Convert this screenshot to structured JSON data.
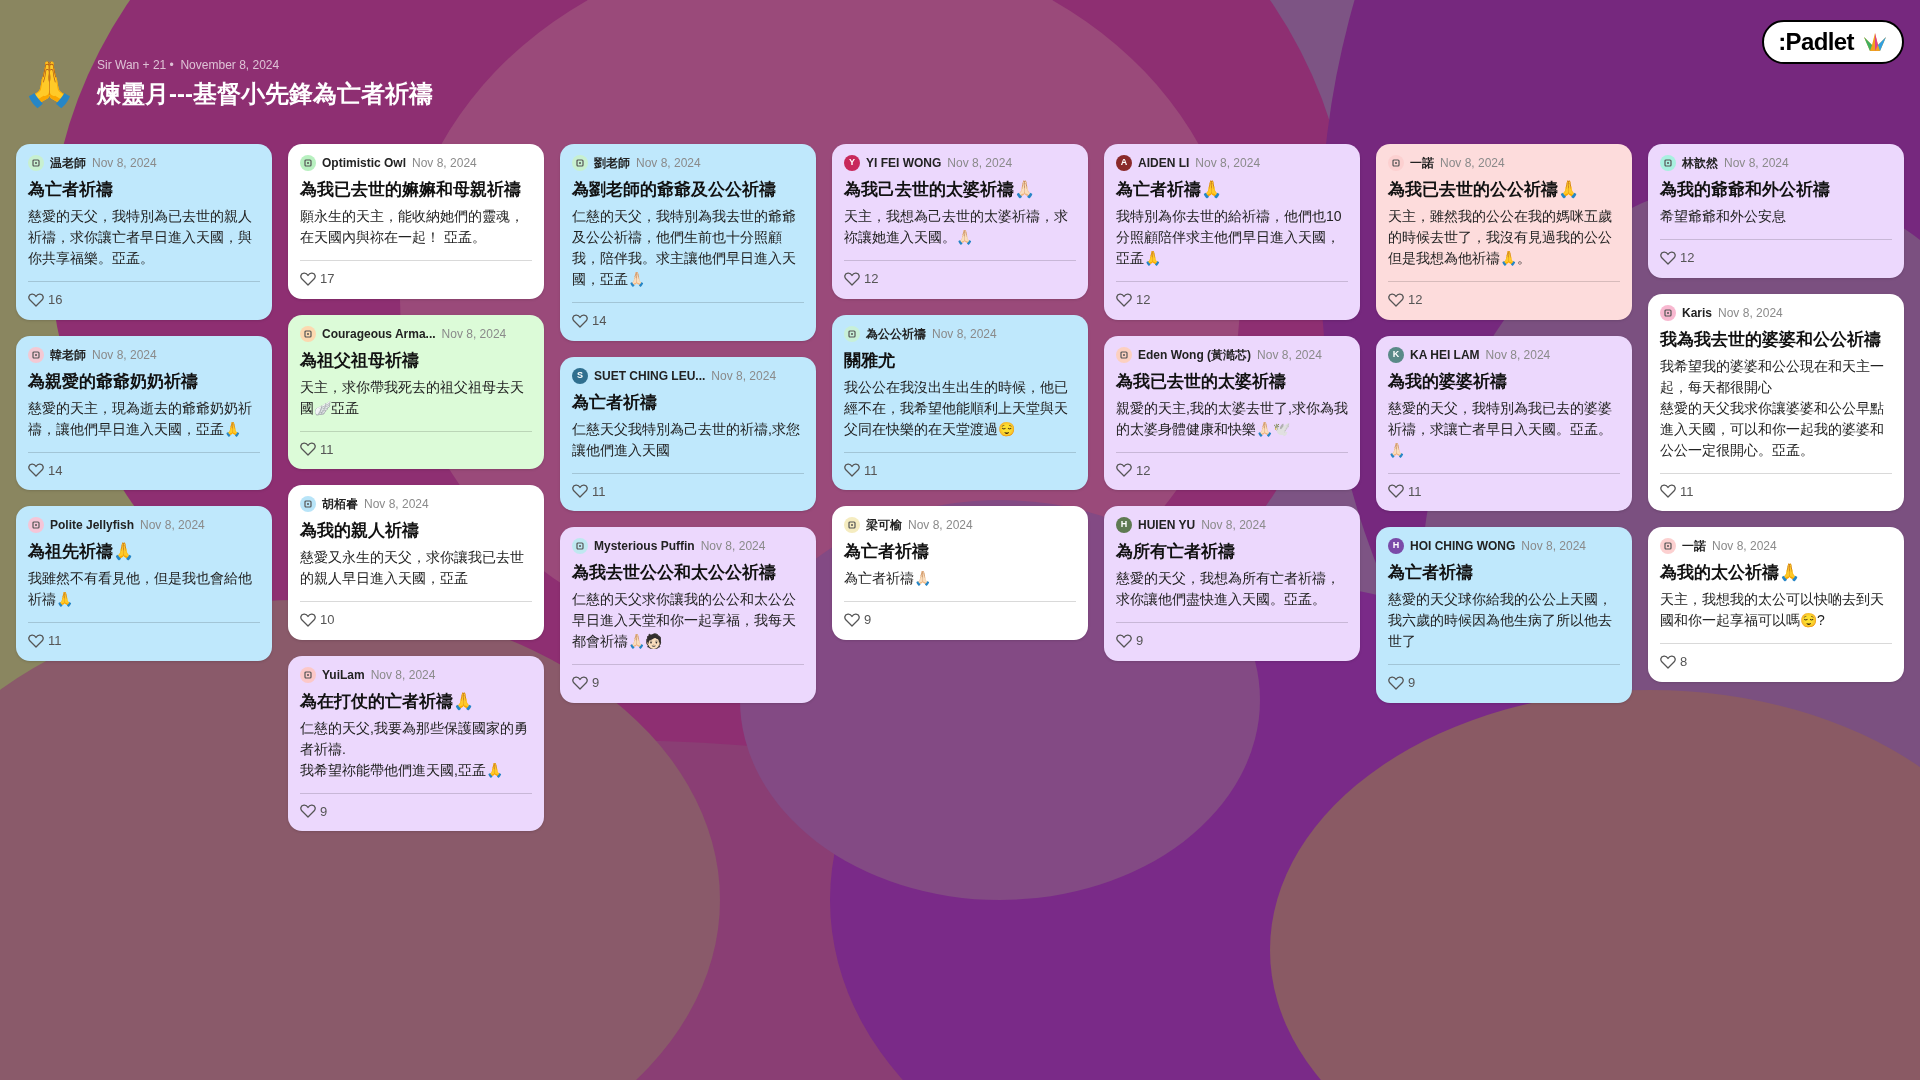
{
  "header": {
    "emoji": "🙏",
    "meta": "Sir Wan + 21 •  November 8, 2024",
    "title": "煉靈月---基督小先鋒為亡者祈禱"
  },
  "logo": ":Padlet",
  "columns": [
    {
      "cards": [
        {
          "author": "温老師",
          "avatar": {
            "color": "#c8f0d0"
          },
          "date": "Nov 8, 2024",
          "title": "為亡者祈禱",
          "body": "慈愛的天父，我特別為已去世的親人祈禱，求你讓亡者早日進入天國，與你共享福樂。亞孟。",
          "likes": "16",
          "color": "#bfe8fc"
        },
        {
          "author": "韓老師",
          "avatar": {
            "color": "#f3c9d4"
          },
          "date": "Nov 8, 2024",
          "title": "為親愛的爺爺奶奶祈禱",
          "body": "慈愛的天主，現為逝去的爺爺奶奶祈禱，讓他們早日進入天國，亞孟🙏",
          "likes": "14",
          "color": "#bfe8fc"
        },
        {
          "author": "Polite Jellyfish",
          "avatar": {
            "color": "#f5c6d8"
          },
          "date": "Nov 8, 2024",
          "title": "為祖先祈禱🙏",
          "body": "我雖然不有看見他，但是我也會給他祈禱🙏",
          "likes": "11",
          "color": "#bfe8fc"
        }
      ]
    },
    {
      "cards": [
        {
          "author": "Optimistic Owl",
          "avatar": {
            "color": "#b8f0c0"
          },
          "date": "Nov 8, 2024",
          "title": "為我已去世的嫲嫲和母親祈禱",
          "body": "願永生的天主，能收納她們的靈魂，在天國內與祢在一起！ 亞孟。",
          "likes": "17",
          "color": "#ffffff"
        },
        {
          "author": "Courageous Arma...",
          "avatar": {
            "color": "#fcd9b0"
          },
          "date": "Nov 8, 2024",
          "title": "為祖父祖母祈禱",
          "body": "天主，求你帶我死去的祖父祖母去天國🪽亞孟",
          "likes": "11",
          "color": "#dcfbd8"
        },
        {
          "author": "胡栢睿",
          "avatar": {
            "color": "#b8e4f8"
          },
          "date": "Nov 8, 2024",
          "title": "為我的親人祈禱",
          "body": "慈愛又永生的天父，求你讓我已去世的親人早日進入天國，亞孟",
          "likes": "10",
          "color": "#ffffff"
        },
        {
          "author": "YuiLam",
          "avatar": {
            "color": "#fcc8c8"
          },
          "date": "Nov 8, 2024",
          "title": "為在打仗的亡者祈禱🙏",
          "body": [
            "仁慈的天父,我要為那些保護國家的勇者祈禱.",
            "我希望祢能帶他們進天國,亞孟🙏"
          ],
          "likes": "9",
          "color": "#ecd8fd"
        }
      ]
    },
    {
      "cards": [
        {
          "author": "劉老師",
          "avatar": {
            "color": "#c8f0d0"
          },
          "date": "Nov 8, 2024",
          "title": "為劉老師的爺爺及公公祈禱",
          "body": "仁慈的天父，我特別為我去世的爺爺及公公祈禱，他們生前也十分照顧我，陪伴我。求主讓他們早日進入天國，亞孟🙏🏻",
          "likes": "14",
          "color": "#bfe8fc"
        },
        {
          "author": "SUET CHING LEU...",
          "avatar": {
            "color": "#2f6f8f",
            "letter": "S"
          },
          "date": "Nov 8, 2024",
          "title": "為亡者祈禱",
          "body": "仁慈天父我特別為己去世的祈禱,求您讓他們進入天國",
          "likes": "11",
          "color": "#bfe8fc"
        },
        {
          "author": "Mysterious Puffin",
          "avatar": {
            "color": "#bfe8f0"
          },
          "date": "Nov 8, 2024",
          "title": "為我去世公公和太公公祈禱",
          "body": "仁慈的天父求你讓我的公公和太公公早日進入天堂和你一起享福，我每天都會祈禱🙏🏻🧑🏻",
          "likes": "9",
          "color": "#ecd8fd"
        }
      ]
    },
    {
      "cards": [
        {
          "author": "YI FEI WONG",
          "avatar": {
            "color": "#c8285a",
            "letter": "Y"
          },
          "date": "Nov 8, 2024",
          "title": "為我己去世的太婆祈禱🙏🏻",
          "body": "天主，我想為己去世的太婆祈禱，求祢讓她進入天國。🙏🏻",
          "likes": "12",
          "color": "#ecd8fd"
        },
        {
          "author": "為公公祈禱",
          "avatar": {
            "color": "#c8f0d8"
          },
          "date": "Nov 8, 2024",
          "title": "關雅尤",
          "body": "我公公在我沒出生出生的時候，他已經不在，我希望他能順利上天堂與天父同在快樂的在天堂渡過😌",
          "likes": "11",
          "color": "#bfe8fc"
        },
        {
          "author": "梁可榆",
          "avatar": {
            "color": "#f5ecc0"
          },
          "date": "Nov 8, 2024",
          "title": "為亡者祈禱",
          "body": "為亡者祈禱🙏🏻",
          "likes": "9",
          "color": "#ffffff"
        }
      ]
    },
    {
      "cards": [
        {
          "author": "AIDEN LI",
          "avatar": {
            "color": "#8a2a2a",
            "letter": "A"
          },
          "date": "Nov 8, 2024",
          "title": "為亡者祈禱🙏",
          "body": "我特別為你去世的給祈禱，他們也10分照顧陪伴求主他們早日進入天國，亞孟🙏",
          "likes": "12",
          "color": "#ecd8fd"
        },
        {
          "author": "Eden Wong (黃澔芯)",
          "avatar": {
            "color": "#fcd0c0"
          },
          "date": "Nov 8, 2024",
          "title": "為我已去世的太婆祈禱",
          "body": "親愛的天主,我的太婆去世了,求你為我的太婆身體健康和快樂🙏🏻🕊️",
          "likes": "12",
          "color": "#ecd8fd"
        },
        {
          "author": "HUIEN YU",
          "avatar": {
            "color": "#5f7a52",
            "letter": "H"
          },
          "date": "Nov 8, 2024",
          "title": "為所有亡者祈禱",
          "body": "慈愛的天父，我想為所有亡者祈禱，求你讓他們盡快進入天國。亞孟。",
          "likes": "9",
          "color": "#ecd8fd"
        }
      ]
    },
    {
      "cards": [
        {
          "author": "一諾",
          "avatar": {
            "color": "#fcd0d0"
          },
          "date": "Nov 8, 2024",
          "title": "為我已去世的公公祈禱🙏",
          "body": "天主，雖然我的公公在我的媽咪五歲的時候去世了，我沒有見過我的公公但是我想為他祈禱🙏。",
          "likes": "12",
          "color": "#fddcdc"
        },
        {
          "author": "KA HEI LAM",
          "avatar": {
            "color": "#5a8a88",
            "letter": "K"
          },
          "date": "Nov 8, 2024",
          "title": "為我的婆婆祈禱",
          "body": "慈愛的天父，我特別為我已去的婆婆祈禱，求讓亡者早日入天國。亞孟。🙏🏻",
          "likes": "11",
          "color": "#ecd8fd"
        },
        {
          "author": "HOI CHING WONG",
          "avatar": {
            "color": "#7a4aa8",
            "letter": "H"
          },
          "date": "Nov 8, 2024",
          "title": "為亡者祈禱",
          "body": "慈愛的天父球你給我的公公上天國，我六歲的時候因為他生病了所以他去世了",
          "likes": "9",
          "color": "#bfe8fc"
        }
      ]
    },
    {
      "cards": [
        {
          "author": "林歆然",
          "avatar": {
            "color": "#a8f0e0"
          },
          "date": "Nov 8, 2024",
          "title": "為我的爺爺和外公祈禱",
          "body": "希望爺爺和外公安息",
          "likes": "12",
          "color": "#ecd8fd"
        },
        {
          "author": "Karis",
          "avatar": {
            "color": "#f8b8d0"
          },
          "date": "Nov 8, 2024",
          "title": "我為我去世的婆婆和公公祈禱",
          "body": [
            "我希望我的婆婆和公公現在和天主一起，每天都很開心",
            "慈愛的天父我求你讓婆婆和公公早點進入天國，可以和你一起我的婆婆和公公一定很開心。亞孟。"
          ],
          "likes": "11",
          "color": "#ffffff"
        },
        {
          "author": "一諾",
          "avatar": {
            "color": "#fcd0d0"
          },
          "date": "Nov 8, 2024",
          "title": "為我的太公祈禱🙏",
          "body": "天主，我想我的太公可以快啲去到天國和你一起享福可以嗎😌?",
          "likes": "8",
          "color": "#ffffff"
        }
      ]
    }
  ]
}
